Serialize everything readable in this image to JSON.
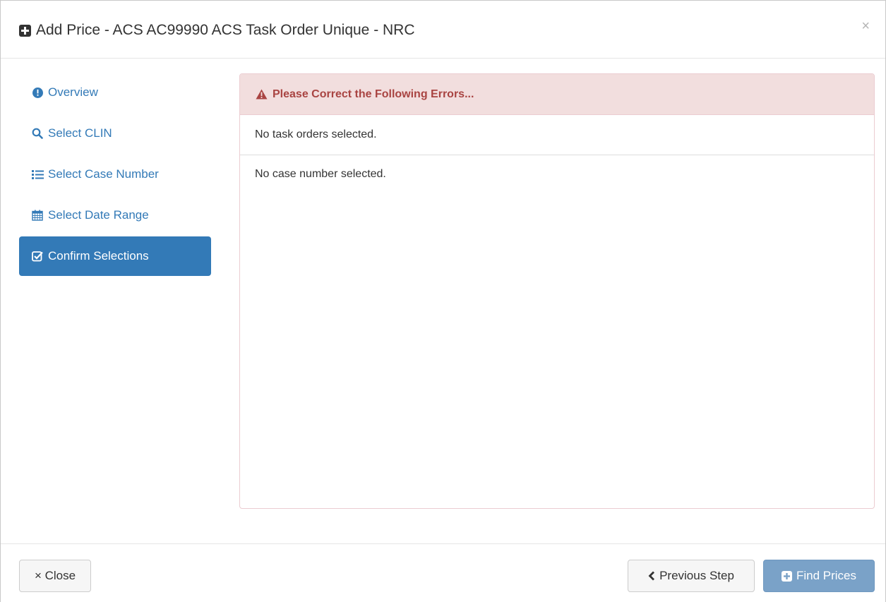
{
  "modal": {
    "title": "Add Price - ACS AC99990 ACS Task Order Unique - NRC",
    "close_symbol": "×"
  },
  "sidebar": {
    "items": [
      {
        "label": "Overview",
        "icon": "info-circle-icon",
        "active": false
      },
      {
        "label": "Select CLIN",
        "icon": "search-icon",
        "active": false
      },
      {
        "label": "Select Case Number",
        "icon": "list-icon",
        "active": false
      },
      {
        "label": "Select Date Range",
        "icon": "calendar-icon",
        "active": false
      },
      {
        "label": "Confirm Selections",
        "icon": "check-square-icon",
        "active": true
      }
    ]
  },
  "errors": {
    "heading": "Please Correct the Following Errors...",
    "items": [
      "No task orders selected.",
      "No case number selected."
    ]
  },
  "footer": {
    "close_label": "× Close",
    "previous_label": "Previous Step",
    "find_label": "Find Prices"
  },
  "colors": {
    "primary": "#337ab7",
    "error_text": "#a94442",
    "error_bg": "#f2dede",
    "error_border": "#ebccd1",
    "disabled_primary": "#7aa2c8"
  }
}
